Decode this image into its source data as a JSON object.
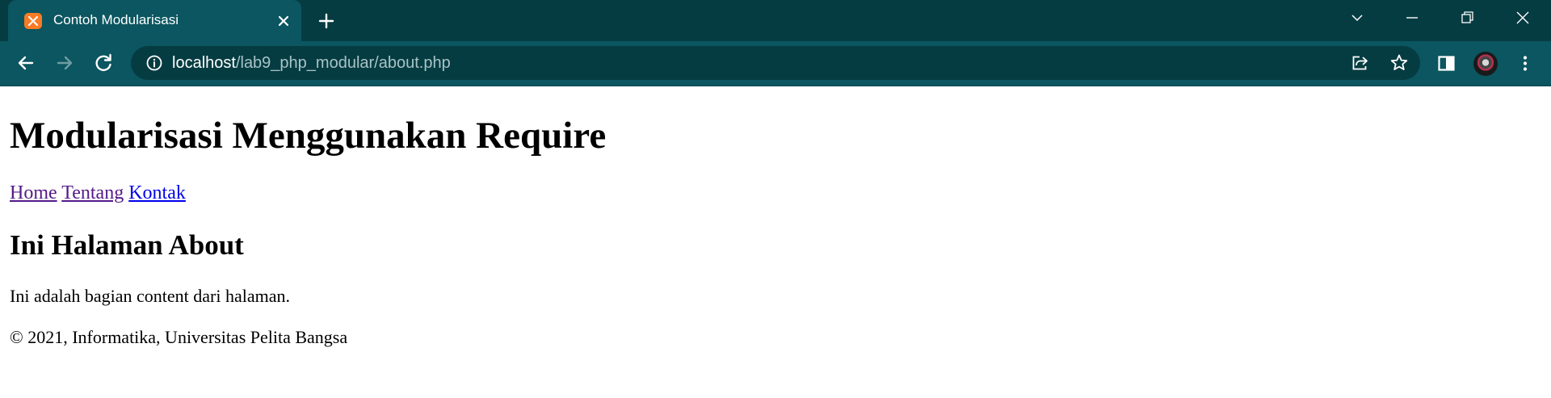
{
  "browser": {
    "tab": {
      "title": "Contoh Modularisasi",
      "favicon": "xampp-icon",
      "favicon_color": "#fb7a24"
    },
    "toolbar": {
      "url_host": "localhost",
      "url_path": "/lab9_php_modular/about.php"
    },
    "colors": {
      "tabstrip_bg": "#053c42",
      "toolbar_bg": "#0b5660",
      "omnibox_bg": "#053c42"
    }
  },
  "page": {
    "heading": "Modularisasi Menggunakan Require",
    "nav": [
      {
        "label": "Home"
      },
      {
        "label": "Tentang"
      },
      {
        "label": "Kontak"
      }
    ],
    "subheading": "Ini Halaman About",
    "content": "Ini adalah bagian content dari halaman.",
    "footer": "© 2021, Informatika, Universitas Pelita Bangsa",
    "colors": {
      "link_visited": "#551a8b",
      "link_unvisited": "#0000ee"
    }
  }
}
